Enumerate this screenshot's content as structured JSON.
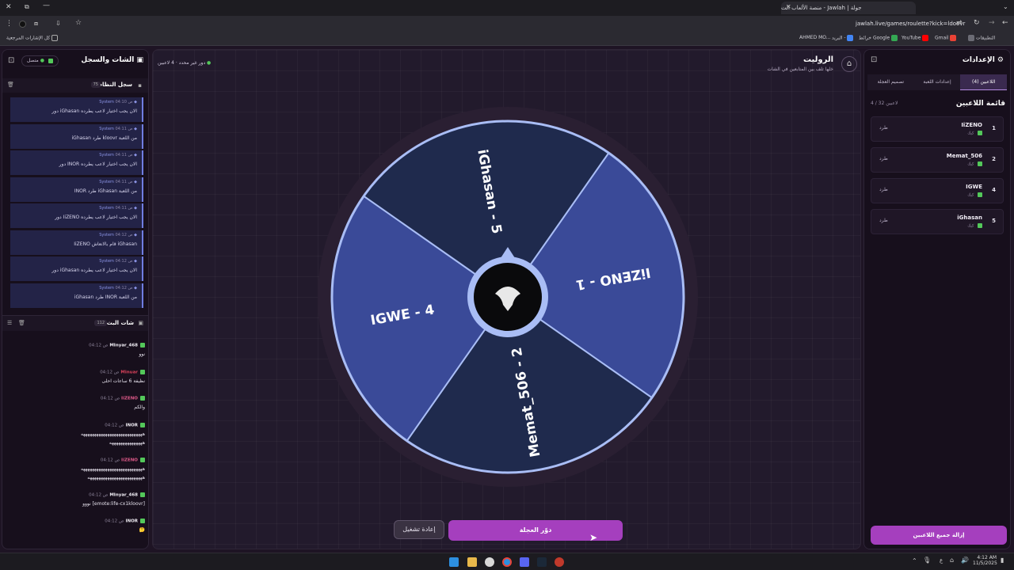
{
  "browser": {
    "tab_title": "جولة | Jawlah - منصة الألعاب الت",
    "url": "jawlah.live/games/roulette?kick=ldoovr",
    "bookmarks": [
      "التطبيقات",
      "Gmail",
      "YouTube",
      "خرائط Google",
      "البريد -",
      "AHMED MO...",
      "كل الإشارات المرجعية"
    ]
  },
  "settings": {
    "title": "الإعدادات",
    "tabs": [
      "اللاعبين (4)",
      "إعدادات اللعبة",
      "تصميم العجلة"
    ],
    "list_title": "قائمة اللاعبين",
    "count": "4 / 32 لاعبين",
    "kick_label": "طرد",
    "platform": "كيك",
    "players": [
      {
        "idx": "1",
        "name": "IiZENO"
      },
      {
        "idx": "2",
        "name": "Memat_506"
      },
      {
        "idx": "4",
        "name": "IGWE"
      },
      {
        "idx": "5",
        "name": "iGhasan"
      }
    ],
    "clear_button": "إزالة جميع اللاعبين"
  },
  "game": {
    "title": "الروليت",
    "subtitle": "خلها تلف بين المتابعين في الشات",
    "players_count": "4 لاعبين",
    "round": "دور غير محدد",
    "spin_button": "دوّر العجلة",
    "restart_button": "إعادة تشغيل",
    "segments": [
      {
        "label": "IiZENO - 1",
        "color": "#3a4a98"
      },
      {
        "label": "Memat_506 - 2",
        "color": "#1f2a4d"
      },
      {
        "label": "IGWE - 4",
        "color": "#3a4a98"
      },
      {
        "label": "iGhasan - 5",
        "color": "#1f2a4d"
      }
    ],
    "ring_color": "#2a1f32",
    "border_color": "#a9bdf5"
  },
  "chat": {
    "title": "الشات والسجل",
    "status": "متصل",
    "log_title": "سجل النظام",
    "log_count": "75",
    "log": [
      {
        "user": "System",
        "time": "04:10 ص",
        "text": "دور iGhasan الان يجب اختيار لاعب يطرده"
      },
      {
        "user": "System",
        "time": "04:11 ص",
        "text": "iGhasan طرد kloovr من اللعبة"
      },
      {
        "user": "System",
        "time": "04:11 ص",
        "text": "دور INOR الان يجب اختيار لاعب يطرده"
      },
      {
        "user": "System",
        "time": "04:11 ص",
        "text": "INOR طرد iGhasan من اللعبة"
      },
      {
        "user": "System",
        "time": "04:11 ص",
        "text": "دور IiZENO الان يجب اختيار لاعب يطرده"
      },
      {
        "user": "System",
        "time": "04:12 ص",
        "text": "IiZENO قام بالانعاش iGhasan"
      },
      {
        "user": "System",
        "time": "04:12 ص",
        "text": "دور iGhasan الان يجب اختيار لاعب يطرده"
      },
      {
        "user": "System",
        "time": "04:12 ص",
        "text": "iGhasan طرد INOR من اللعبة"
      }
    ],
    "live_title": "شات البث",
    "live_count": "112",
    "messages": [
      {
        "user": "MInyar_468",
        "color": "#f3f0f7",
        "time": "04:12 ص",
        "text": "نوو",
        "lines": 1
      },
      {
        "user": "Minuar",
        "color": "#d9415a",
        "time": "04:12 ص",
        "text": "نظيفة 6 ساعات احلى",
        "lines": 1
      },
      {
        "user": "IiZENO",
        "color": "#e05a8a",
        "time": "04:12 ص",
        "text": "والكم",
        "lines": 1
      },
      {
        "user": "INOR",
        "color": "#f3f0f7",
        "time": "04:12 ص",
        "text": "ههههههههههههههههههههههههههههه",
        "text2": "هههههههههههههههه",
        "lines": 2
      },
      {
        "user": "IiZENO",
        "color": "#e05a8a",
        "time": "04:12 ص",
        "text": "ههههههههههههههههههههههههههههه",
        "text2": "هههههههههههههههههههههههههه",
        "lines": 2
      },
      {
        "user": "MInyar_468",
        "color": "#f3f0f7",
        "time": "04:12 ص",
        "text": "نووو [emote:life-cx1kloovr]",
        "lines": 1
      },
      {
        "user": "INOR",
        "color": "#f3f0f7",
        "time": "04:12 ص",
        "text": "🤔",
        "lines": 1
      }
    ]
  },
  "taskbar": {
    "time": "4:12 AM",
    "date": "11/5/2025",
    "lang": "ع"
  }
}
